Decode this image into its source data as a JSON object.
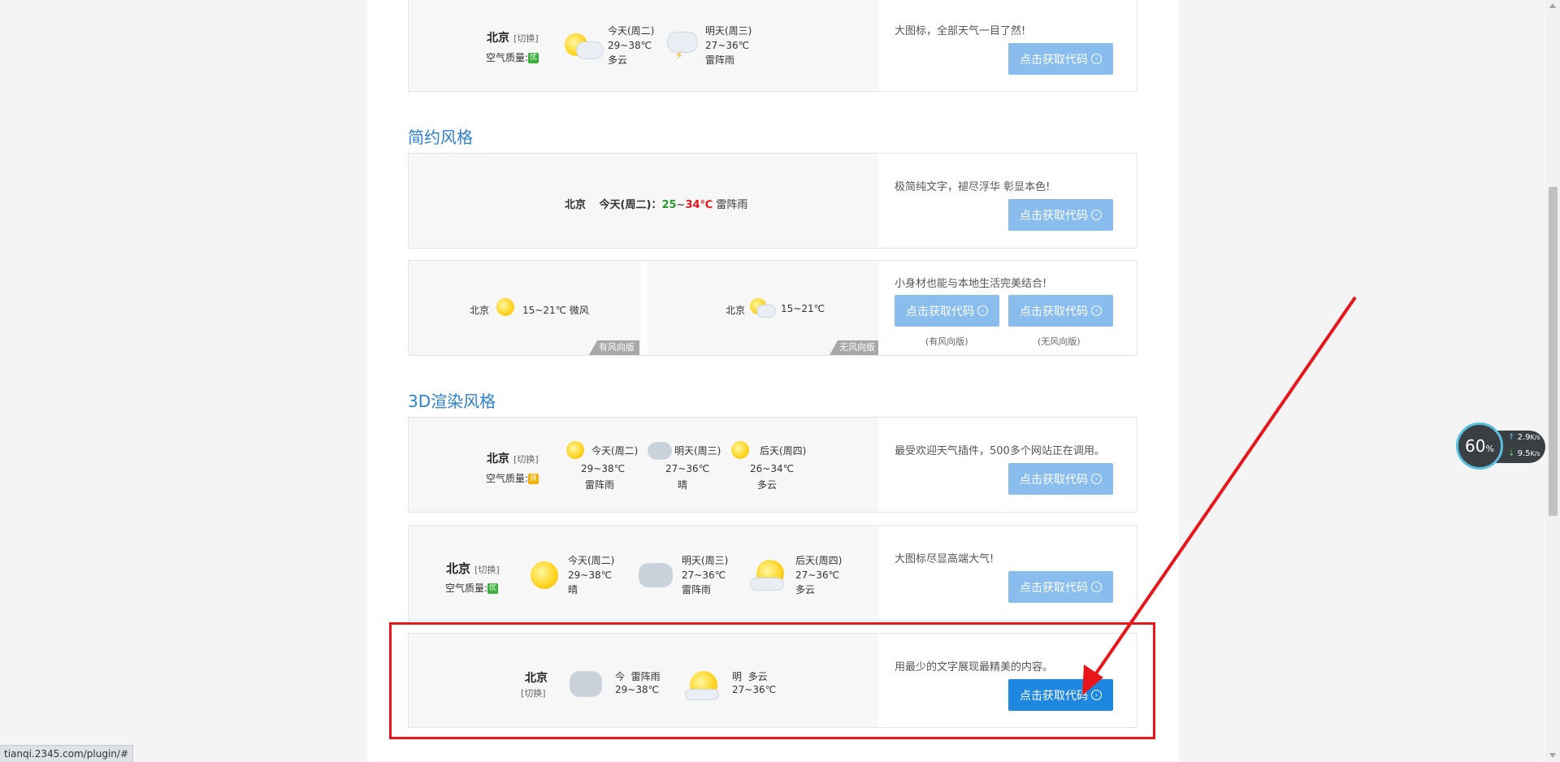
{
  "panel1": {
    "city": "北京",
    "switch": "[切换]",
    "air_label": "空气质量:",
    "air_val": "优",
    "d1": {
      "title": "今天(周二)",
      "temp": "29~38℃",
      "desc": "多云"
    },
    "d2": {
      "title": "明天(周三)",
      "temp": "27~36℃",
      "desc": "雷阵雨"
    },
    "side_desc": "大图标，全部天气一目了然!",
    "btn": "点击获取代码"
  },
  "section_simple": "简约风格",
  "panel2": {
    "city": "北京",
    "today": "今天(周二)：",
    "t_low": "25",
    "t_sep": "~",
    "t_high": "34",
    "unit": "℃",
    "desc": "雷阵雨",
    "side_desc": "极简纯文字，褪尽浮华 彰显本色!",
    "btn": "点击获取代码"
  },
  "panel3": {
    "a": {
      "city": "北京",
      "temp": "15~21℃",
      "wind": "微风",
      "tag": "有风向版"
    },
    "b": {
      "city": "北京",
      "temp": "15~21℃",
      "tag": "无风向版"
    },
    "side_desc": "小身材也能与本地生活完美结合!",
    "btn1": "点击获取代码",
    "btn2": "点击获取代码",
    "cap1": "(有风向版)",
    "cap2": "(无风向版)"
  },
  "section_3d": "3D渲染风格",
  "panel4": {
    "city": "北京",
    "switch": "[切换]",
    "air_label": "空气质量:",
    "air_val": "良",
    "d1": {
      "title": "今天(周二)",
      "temp": "29~38℃",
      "desc": "雷阵雨"
    },
    "d2": {
      "title": "明天(周三)",
      "temp": "27~36℃",
      "desc": "晴"
    },
    "d3": {
      "title": "后天(周四)",
      "temp": "26~34℃",
      "desc": "多云"
    },
    "side_desc": "最受欢迎天气插件，500多个网站正在调用。",
    "btn": "点击获取代码"
  },
  "panel5": {
    "city": "北京",
    "switch": "[切换]",
    "air_label": "空气质量:",
    "air_val": "优",
    "d1": {
      "title": "今天(周二)",
      "temp": "29~38℃",
      "desc": "晴"
    },
    "d2": {
      "title": "明天(周三)",
      "temp": "27~36℃",
      "desc": "雷阵雨"
    },
    "d3": {
      "title": "后天(周四)",
      "temp": "27~36℃",
      "desc": "多云"
    },
    "side_desc": "大图标尽显高端大气!",
    "btn": "点击获取代码"
  },
  "panel6": {
    "city": "北京",
    "switch": "[切换]",
    "d1": {
      "label": "今",
      "desc": "雷阵雨",
      "temp": "29~38℃"
    },
    "d2": {
      "label": "明",
      "desc": "多云",
      "temp": "27~36℃"
    },
    "side_desc": "用最少的文字展现最精美的内容。",
    "btn": "点击获取代码"
  },
  "status_url": "tianqi.2345.com/plugin/#",
  "net": {
    "percent": "60",
    "unit": "%",
    "up": "2.9",
    "down": "9.5",
    "rate_unit": "K/s"
  },
  "colors": {
    "accent": "#1e88e0",
    "btn": "#88bdee",
    "highlight": "#e8161b",
    "green": "#2a9b2a",
    "red": "#e8161b"
  }
}
